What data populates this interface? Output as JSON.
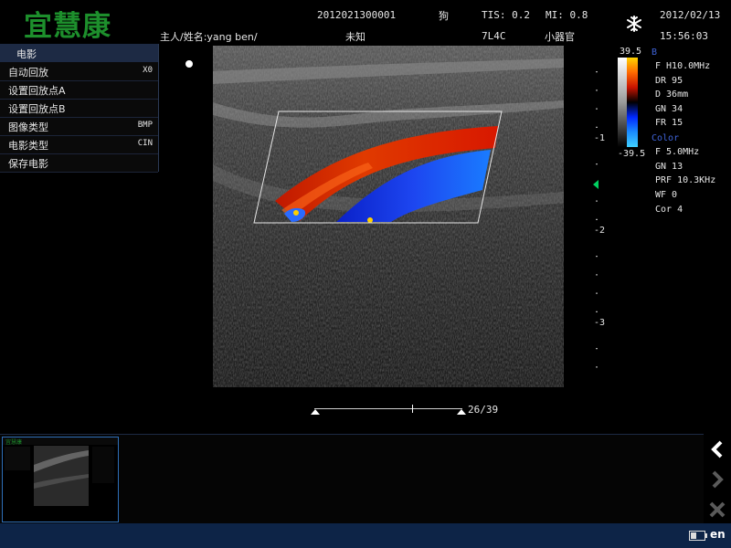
{
  "header": {
    "logo": "宜慧康",
    "patient_id": "2012021300001",
    "species": "狗",
    "tis": "TIS: 0.2",
    "mi": "MI: 0.8",
    "date": "2012/02/13",
    "owner": "主人/姓名:yang ben/",
    "unknown": "未知",
    "probe": "7L4C",
    "preset": "小器官",
    "time": "15:56:03",
    "freeze_icon": "snowflake-icon"
  },
  "menu": {
    "title": "电影",
    "items": [
      {
        "label": "自动回放",
        "value": "X0"
      },
      {
        "label": "设置回放点A",
        "value": ""
      },
      {
        "label": "设置回放点B",
        "value": ""
      },
      {
        "label": "图像类型",
        "value": "BMP"
      },
      {
        "label": "电影类型",
        "value": "CIN"
      },
      {
        "label": "保存电影",
        "value": ""
      }
    ]
  },
  "color_bar": {
    "top": "39.5",
    "bottom": "-39.5",
    "colors": [
      "#ffd400",
      "#ff6a00",
      "#c81400",
      "#000000",
      "#0028ff",
      "#1a8cff",
      "#40d0ff"
    ]
  },
  "depth_scale": {
    "labels": [
      "-1",
      "-2",
      "-3"
    ]
  },
  "b_params": {
    "label": "B",
    "lines": [
      "F   H10.0MHz",
      "DR  95",
      "D   36mm",
      "GN  34",
      "FR  15"
    ]
  },
  "color_params": {
    "label": "Color",
    "lines": [
      "F   5.0MHz",
      "GN  13",
      "PRF 10.3KHz",
      "WF  0",
      "Cor 4"
    ]
  },
  "cine": {
    "frame": "26/39",
    "position": 0.66
  },
  "thumbnail": {
    "logo": "宜慧康"
  },
  "nav": {
    "back_icon": "chevron-left-icon",
    "forward_icon": "chevron-right-icon",
    "close_icon": "close-icon"
  },
  "status": {
    "battery_icon": "battery-icon",
    "language": "en"
  }
}
